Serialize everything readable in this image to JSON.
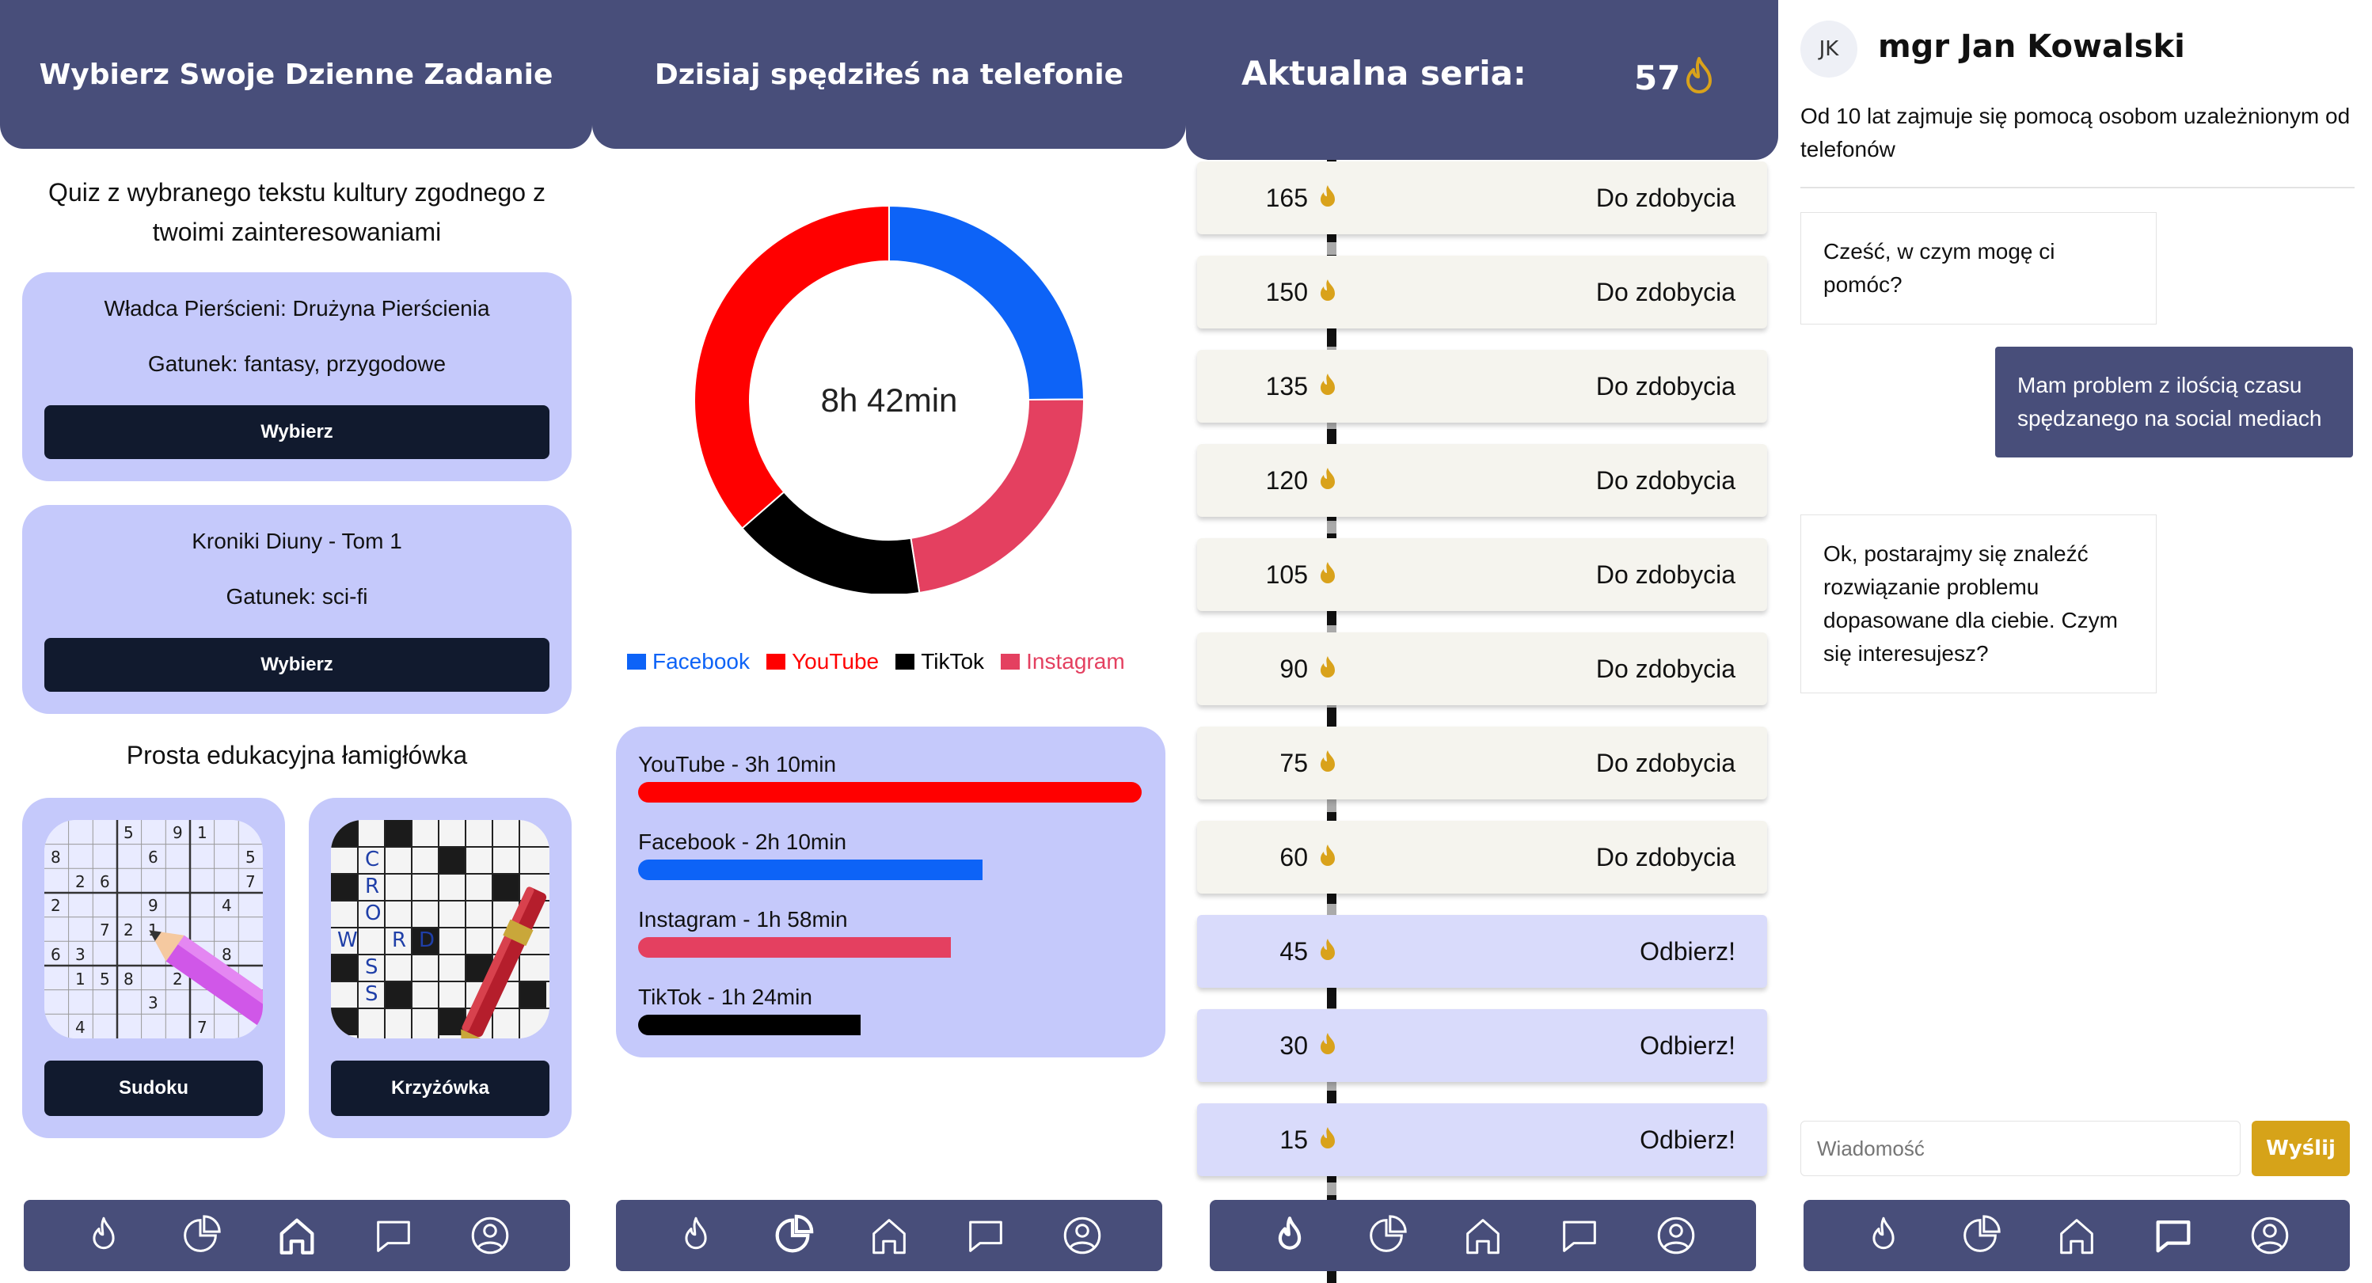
{
  "colors": {
    "primary": "#484e7a",
    "card": "#c5c9fb",
    "button_dark": "#111a2e",
    "facebook": "#0d63f7",
    "youtube": "#ff0000",
    "tiktok": "#000000",
    "instagram": "#e44060",
    "flame": "#d9a21b",
    "send": "#d6a319"
  },
  "screen1": {
    "header": "Wybierz Swoje Dzienne Zadanie",
    "quiz_intro": "Quiz z wybranego tekstu kultury zgodnego z twoimi zainteresowaniami",
    "quizzes": [
      {
        "title": "Władca Pierścieni: Drużyna Pierścienia",
        "genre": "Gatunek: fantasy, przygodowe",
        "button": "Wybierz"
      },
      {
        "title": "Kroniki Diuny - Tom 1",
        "genre": "Gatunek: sci-fi",
        "button": "Wybierz"
      }
    ],
    "puzzle_intro": "Prosta edukacyjna łamigłówka",
    "puzzles": [
      {
        "button": "Sudoku"
      },
      {
        "button": "Krzyżówka"
      }
    ],
    "crossword_words": [
      "C",
      "R",
      "O",
      "S",
      "S",
      "W",
      "O",
      "R",
      "D"
    ]
  },
  "screen2": {
    "header": "Dzisiaj spędziłeś na telefonie",
    "total": "8h 42min",
    "legend": [
      "Facebook",
      "YouTube",
      "TikTok",
      "Instagram"
    ],
    "bars": [
      {
        "label": "YouTube - 3h 10min",
        "minutes": 190
      },
      {
        "label": "Facebook - 2h 10min",
        "minutes": 130
      },
      {
        "label": "Instagram - 1h 58min",
        "minutes": 118
      },
      {
        "label": "TikTok - 1h 24min",
        "minutes": 84
      }
    ]
  },
  "chart_data": {
    "type": "pie",
    "categories": [
      "Facebook",
      "Instagram",
      "TikTok",
      "YouTube"
    ],
    "values": [
      130,
      118,
      84,
      190
    ],
    "title": "",
    "center_label": "8h 42min"
  },
  "screen3": {
    "header": "Aktualna seria:",
    "streak_count": "57",
    "rows": [
      {
        "num": "165",
        "text": "Do zdobycia",
        "claimable": false
      },
      {
        "num": "150",
        "text": "Do zdobycia",
        "claimable": false
      },
      {
        "num": "135",
        "text": "Do zdobycia",
        "claimable": false
      },
      {
        "num": "120",
        "text": "Do zdobycia",
        "claimable": false
      },
      {
        "num": "105",
        "text": "Do zdobycia",
        "claimable": false
      },
      {
        "num": "90",
        "text": "Do zdobycia",
        "claimable": false
      },
      {
        "num": "75",
        "text": "Do zdobycia",
        "claimable": false
      },
      {
        "num": "60",
        "text": "Do zdobycia",
        "claimable": false
      },
      {
        "num": "45",
        "text": "Odbierz!",
        "claimable": true
      },
      {
        "num": "30",
        "text": "Odbierz!",
        "claimable": true
      },
      {
        "num": "15",
        "text": "Odbierz!",
        "claimable": true
      }
    ]
  },
  "screen4": {
    "avatar": "JK",
    "name": "mgr Jan Kowalski",
    "bio": "Od 10 lat zajmuje się pomocą osobom uzależnionym od telefonów",
    "messages": [
      {
        "from": "other",
        "text": "Cześć, w czym mogę ci pomóc?"
      },
      {
        "from": "me",
        "text": "Mam problem z ilością czasu spędzanego na social mediach"
      },
      {
        "from": "other",
        "text": "Ok, postarajmy się znaleźć rozwiązanie problemu dopasowane dla ciebie. Czym się interesujesz?"
      }
    ],
    "input_placeholder": "Wiadomość",
    "send_label": "Wyślij"
  },
  "nav": [
    "flame-icon",
    "pie-chart-icon",
    "home-icon",
    "chat-icon",
    "profile-icon"
  ]
}
